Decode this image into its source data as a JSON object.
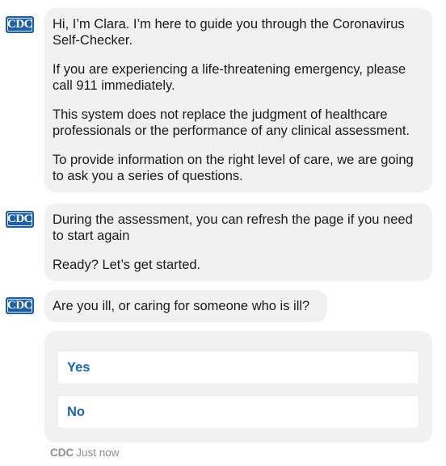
{
  "messages": [
    {
      "sender": "CDC",
      "paragraphs": [
        "Hi, I’m Clara. I’m here to guide you through the Coronavirus Self-Checker.",
        "If you are experiencing a life-threatening emergency, please call 911 immediately.",
        "This system does not replace the judgment of healthcare professionals or the performance of any clinical assessment.",
        "To provide information on the right level of care, we are going to ask you a series of questions."
      ]
    },
    {
      "sender": "CDC",
      "paragraphs": [
        "During the assessment, you can refresh the page if you need to start again",
        "Ready? Let’s get started."
      ]
    },
    {
      "sender": "CDC",
      "paragraphs": [
        "Are you ill, or caring for someone who is ill?"
      ]
    }
  ],
  "options": [
    {
      "label": "Yes"
    },
    {
      "label": "No"
    }
  ],
  "footer": {
    "sender": "CDC",
    "time": "Just now"
  },
  "colors": {
    "brand_blue": "#1c5fa6",
    "option_text": "#1c64a6",
    "bubble_bg": "#f1f1f1"
  }
}
